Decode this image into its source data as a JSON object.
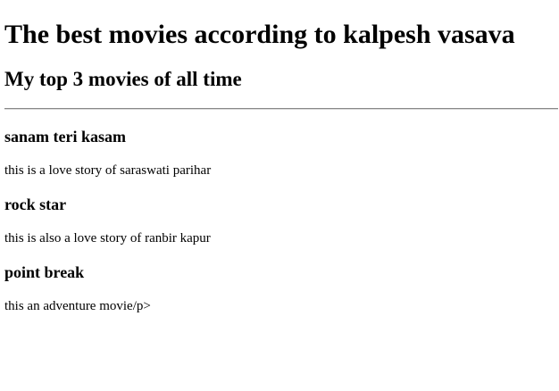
{
  "page": {
    "title": "The best movies according to kalpesh vasava",
    "subtitle": "My top 3 movies of all time"
  },
  "movies": [
    {
      "title": "sanam teri kasam",
      "description": "this is a love story of saraswati parihar"
    },
    {
      "title": "rock star",
      "description": "this is also a love story of ranbir kapur"
    },
    {
      "title": "point break",
      "description": "this an adventure movie/p>"
    }
  ]
}
